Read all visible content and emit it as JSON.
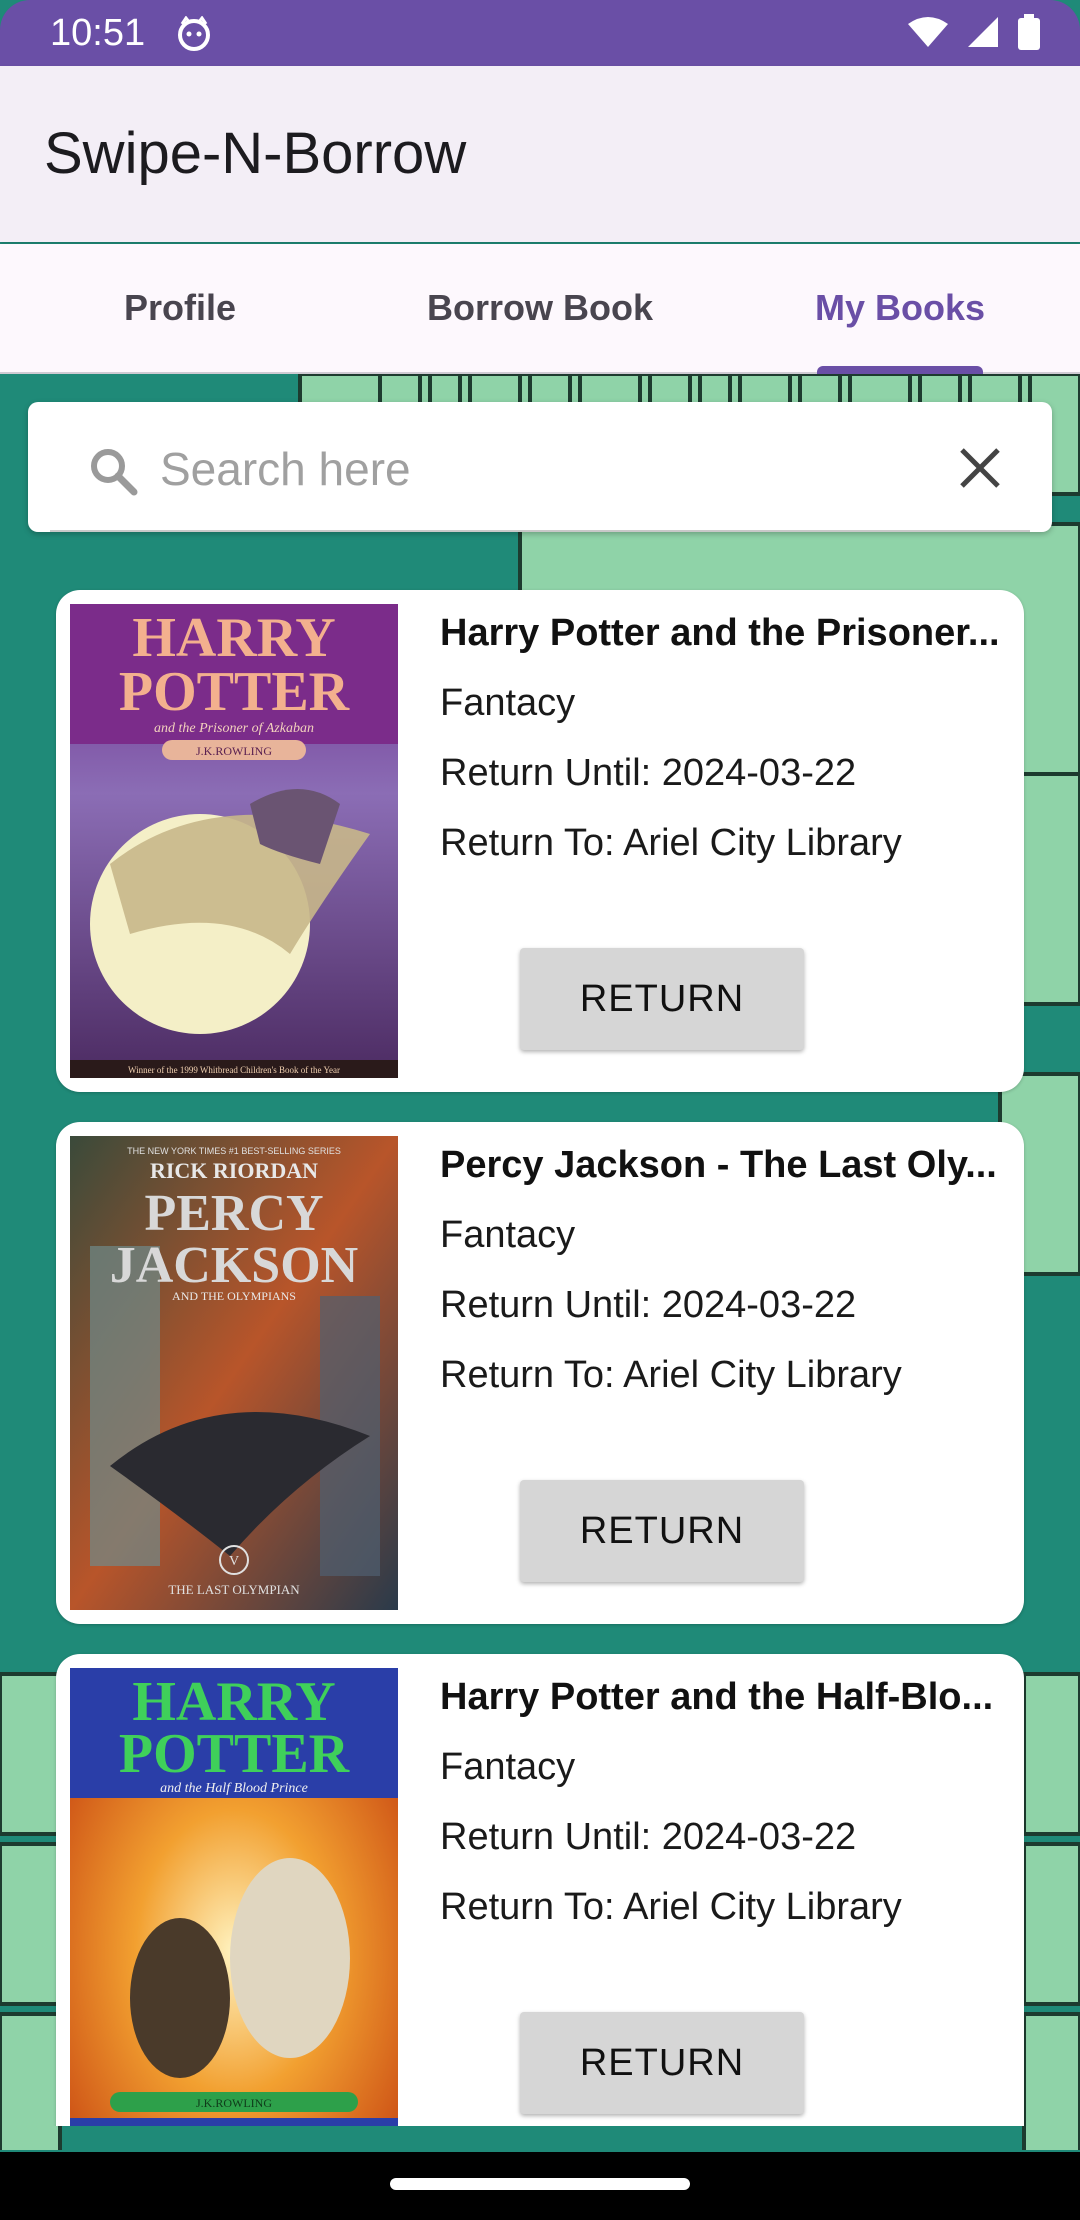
{
  "status_bar": {
    "time": "10:51"
  },
  "app_bar": {
    "title": "Swipe-N-Borrow"
  },
  "tabs": [
    {
      "label": "Profile",
      "active": false
    },
    {
      "label": "Borrow Book",
      "active": false
    },
    {
      "label": "My Books",
      "active": true
    }
  ],
  "search": {
    "placeholder": "Search here",
    "value": ""
  },
  "books": [
    {
      "title": "Harry Potter and the Prisoner...",
      "genre": "Fantacy",
      "return_until": "Return Until: 2024-03-22",
      "return_to": "Return To: Ariel City Library",
      "button": "RETURN",
      "cover": {
        "line1": "HARRY",
        "line2": "POTTER",
        "subtitle": "and the Prisoner of Azkaban",
        "author": "J.K.ROWLING",
        "footer": "Winner of the 1999 Whitbread Children's Book of the Year"
      }
    },
    {
      "title": "Percy Jackson - The Last Oly...",
      "genre": "Fantacy",
      "return_until": "Return Until: 2024-03-22",
      "return_to": "Return To: Ariel City Library",
      "button": "RETURN",
      "cover": {
        "top": "THE NEW YORK TIMES #1 BEST-SELLING SERIES",
        "author": "RICK RIORDAN",
        "line1": "PERCY",
        "line2": "JACKSON",
        "subtitle": "AND THE OLYMPIANS",
        "volume": "V",
        "footer": "THE LAST OLYMPIAN"
      }
    },
    {
      "title": "Harry Potter and the Half-Blo...",
      "genre": "Fantacy",
      "return_until": "Return Until: 2024-03-22",
      "return_to": "Return To: Ariel City Library",
      "button": "RETURN",
      "cover": {
        "line1": "HARRY",
        "line2": "POTTER",
        "subtitle": "and the Half Blood Prince",
        "author": "J.K.ROWLING"
      }
    }
  ],
  "colors": {
    "accent": "#6a4fa6",
    "background": "#1f8a78",
    "card": "#ffffff",
    "button": "#d6d6d6"
  }
}
